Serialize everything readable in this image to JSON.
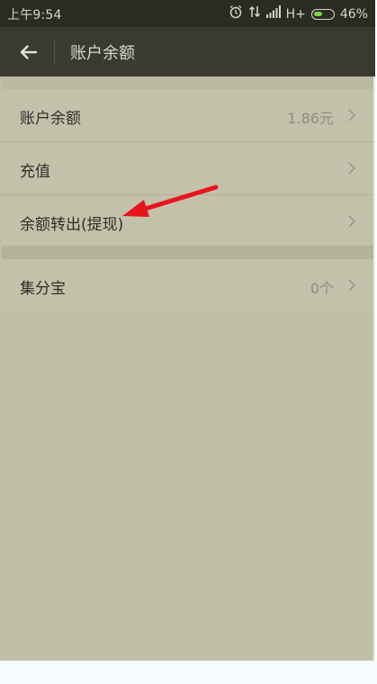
{
  "status_bar": {
    "time": "上午9:54",
    "network": "H+",
    "battery_percent": "46%",
    "battery_level": 0.46,
    "icons": [
      "alarm-icon",
      "data-transfer-icon",
      "signal-icon",
      "battery-icon"
    ]
  },
  "app_bar": {
    "title": "账户余额",
    "back_icon": "back-arrow-icon"
  },
  "list": {
    "balance": {
      "label": "账户余额",
      "value": "1.86元"
    },
    "recharge": {
      "label": "充值",
      "value": ""
    },
    "withdraw": {
      "label": "余额转出(提现)",
      "value": ""
    },
    "jifenbao": {
      "label": "集分宝",
      "value": "0个"
    }
  },
  "colors": {
    "status_bar_bg": "#2b2b24",
    "app_bar_bg": "#3b3a32",
    "screen_bg": "#c2bfa8",
    "annotation_arrow": "#e8141b"
  }
}
